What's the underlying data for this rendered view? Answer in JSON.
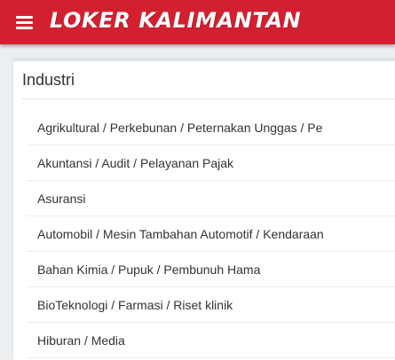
{
  "appbar": {
    "title": "LOKER KALIMANTAN",
    "menu_icon": "hamburger-menu-icon",
    "color": "#d32030"
  },
  "card": {
    "title": "Industri",
    "items": [
      {
        "label": "Agrikultural / Perkebunan / Peternakan Unggas / Pe"
      },
      {
        "label": "Akuntansi / Audit / Pelayanan Pajak"
      },
      {
        "label": "Asuransi"
      },
      {
        "label": "Automobil / Mesin Tambahan Automotif / Kendaraan"
      },
      {
        "label": "Bahan Kimia / Pupuk / Pembunuh Hama"
      },
      {
        "label": "BioTeknologi / Farmasi / Riset klinik"
      },
      {
        "label": "Hiburan / Media"
      }
    ]
  }
}
